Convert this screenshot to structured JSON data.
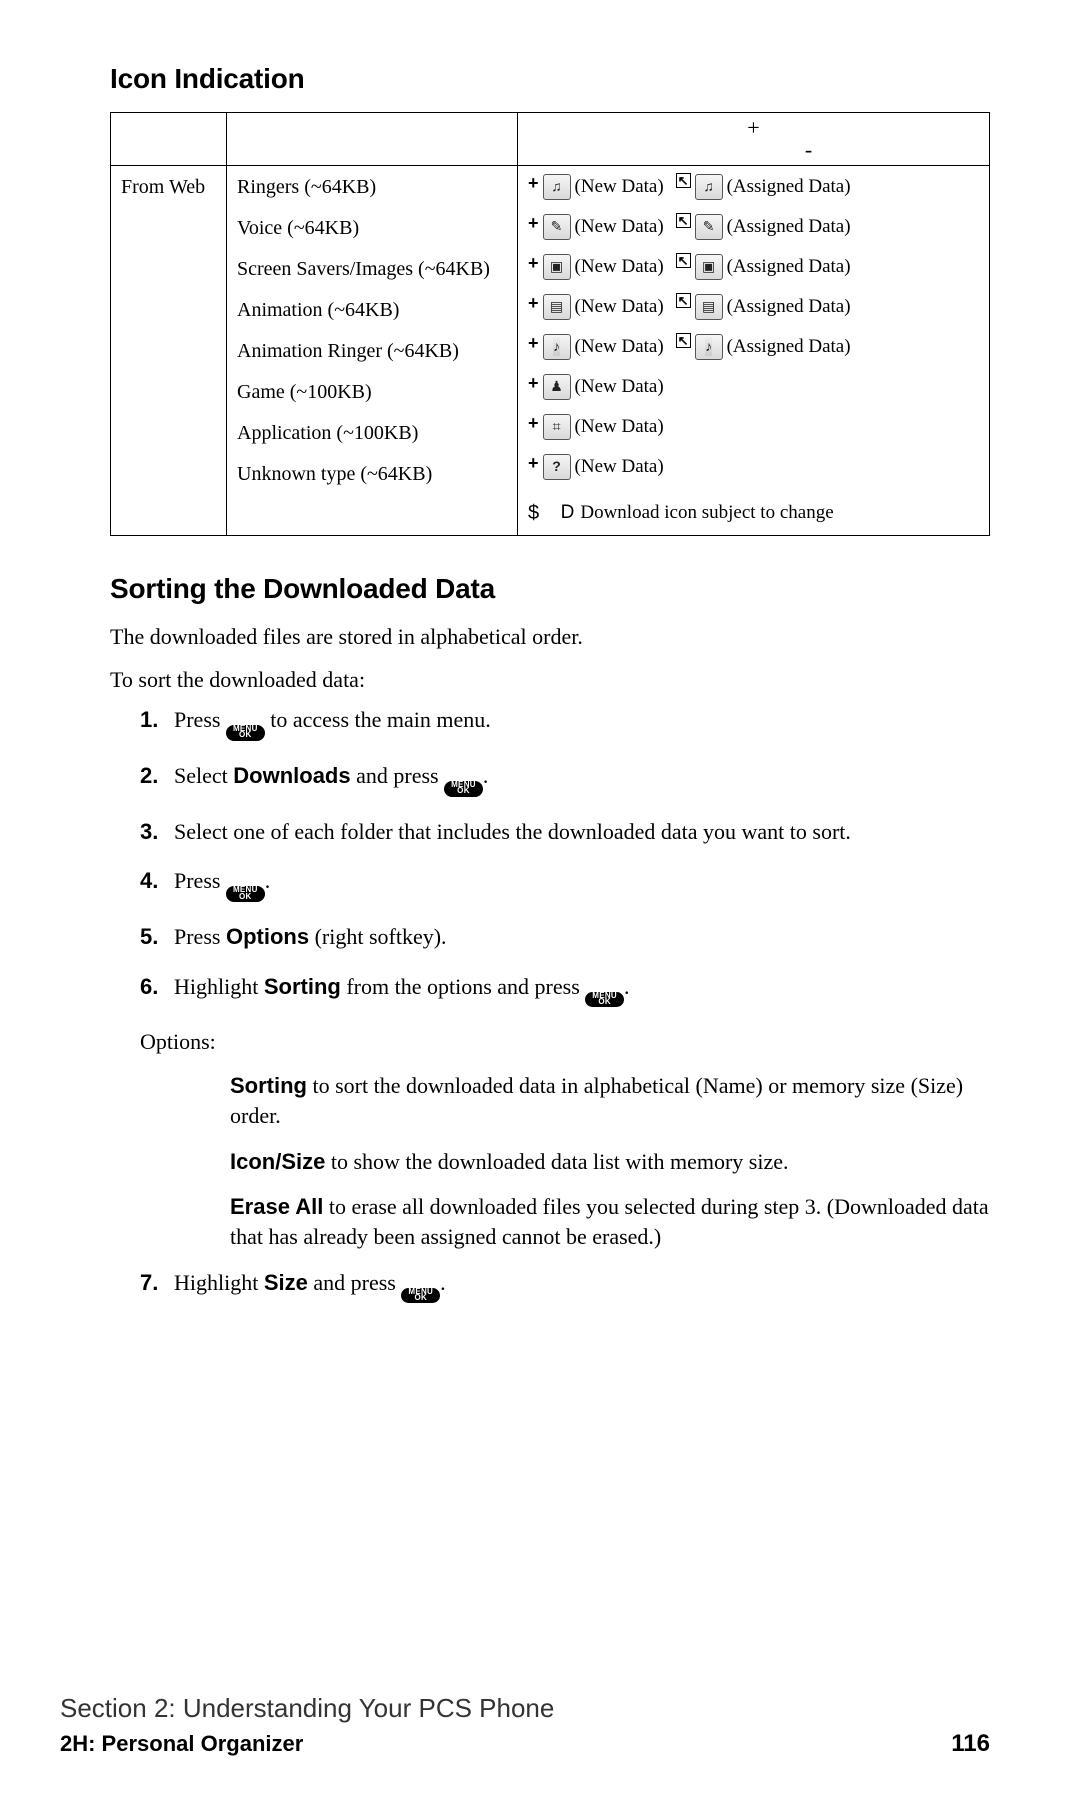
{
  "icon_section": {
    "heading": "Icon Indication",
    "header_plus": "+",
    "header_minus": "-",
    "source_label": "From Web",
    "rows": [
      {
        "type": "Ringers (~64KB)",
        "icon": "music",
        "new": "(New Data)",
        "assigned": "(Assigned Data)"
      },
      {
        "type": "Voice (~64KB)",
        "icon": "voice",
        "new": "(New Data)",
        "assigned": "(Assigned Data)"
      },
      {
        "type": "Screen Savers/Images (~64KB)",
        "icon": "image",
        "new": "(New Data)",
        "assigned": "(Assigned Data)"
      },
      {
        "type": "Animation (~64KB)",
        "icon": "anim",
        "new": "(New Data)",
        "assigned": "(Assigned Data)"
      },
      {
        "type": "Animation Ringer (~64KB)",
        "icon": "aring",
        "new": "(New Data)",
        "assigned": "(Assigned Data)"
      },
      {
        "type": "Game (~100KB)",
        "icon": "game",
        "new": "(New Data)"
      },
      {
        "type": "Application (~100KB)",
        "icon": "app",
        "new": "(New Data)"
      },
      {
        "type": "Unknown type (~64KB)",
        "icon": "unknown",
        "new": "(New Data)"
      }
    ],
    "footnote_prefix": "$",
    "footnote_symbol": "D",
    "footnote_text": "Download icon subject to change"
  },
  "sort_section": {
    "heading": "Sorting the Downloaded Data",
    "intro1": "The downloaded files are stored in alphabetical order.",
    "intro2": "To sort the downloaded data:",
    "menu_top": "MENU",
    "menu_bot": "OK",
    "steps_text": {
      "s1a": "Press ",
      "s1b": " to access the main menu.",
      "s2a": "Select ",
      "s2term": "Downloads",
      "s2b": " and press ",
      "s2c": ".",
      "s3": "Select one of each folder that includes the downloaded data you want to sort.",
      "s4a": "Press ",
      "s4b": ".",
      "s5a": "Press ",
      "s5term": "Options",
      "s5b": " (right softkey).",
      "s6a": "Highlight ",
      "s6term": "Sorting",
      "s6b": " from the options and press ",
      "s6c": ".",
      "opts_label": "Options:",
      "opt_sort_term": "Sorting",
      "opt_sort_body": " to sort the downloaded data in alphabetical (Name) or memory size (Size) order.",
      "opt_icon_term": "Icon/Size",
      "opt_icon_body": " to show the downloaded data list with memory size.",
      "opt_erase_term": "Erase All",
      "opt_erase_body": " to erase all downloaded files you selected during step 3. (Downloaded data that has already been assigned cannot be erased.)",
      "s7a": "Highlight ",
      "s7term": "Size",
      "s7b": " and press ",
      "s7c": "."
    }
  },
  "footer": {
    "line1": "Section 2: Understanding Your PCS Phone",
    "line2": "2H: Personal Organizer",
    "page": "116"
  }
}
